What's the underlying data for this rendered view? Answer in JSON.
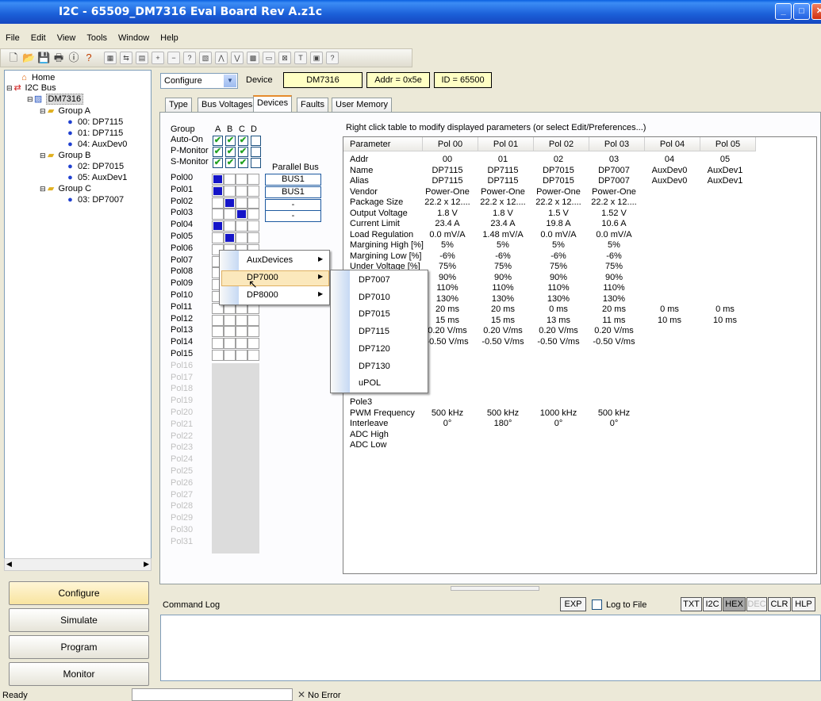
{
  "window": {
    "title": "I2C - 65509_DM7316 Eval Board Rev A.z1c"
  },
  "menu": [
    "File",
    "Edit",
    "View",
    "Tools",
    "Window",
    "Help"
  ],
  "tree": {
    "home": "Home",
    "bus": "I2C Bus",
    "device": "DM7316",
    "group_a": "Group A",
    "a1": "00: DP7115",
    "a2": "01: DP7115",
    "a3": "04: AuxDev0",
    "group_b": "Group B",
    "b1": "02: DP7015",
    "b2": "05: AuxDev1",
    "group_c": "Group C",
    "c1": "03: DP7007"
  },
  "nav": {
    "configure": "Configure",
    "simulate": "Simulate",
    "program": "Program",
    "monitor": "Monitor"
  },
  "topbar": {
    "mode": "Configure",
    "device_label": "Device",
    "device": "DM7316",
    "addr": "Addr = 0x5e",
    "id": "ID = 65500"
  },
  "tabs": [
    "Type",
    "Bus Voltages",
    "Devices",
    "Faults",
    "User Memory"
  ],
  "groups": {
    "label": "Group",
    "cols": [
      "A",
      "B",
      "C",
      "D"
    ],
    "rows": [
      "Auto-On",
      "P-Monitor",
      "S-Monitor"
    ],
    "parallel_bus": "Parallel Bus"
  },
  "pols": [
    "Pol00",
    "Pol01",
    "Pol02",
    "Pol03",
    "Pol04",
    "Pol05",
    "Pol06",
    "Pol07",
    "Pol08",
    "Pol09",
    "Pol10",
    "Pol11",
    "Pol12",
    "Pol13",
    "Pol14",
    "Pol15"
  ],
  "pols_disabled": [
    "Pol16",
    "Pol17",
    "Pol18",
    "Pol19",
    "Pol20",
    "Pol21",
    "Pol22",
    "Pol23",
    "Pol24",
    "Pol25",
    "Pol26",
    "Pol27",
    "Pol28",
    "Pol29",
    "Pol30",
    "Pol31"
  ],
  "busboxes": [
    "BUS1",
    "BUS1",
    "-",
    "-"
  ],
  "hint": "Right click table to modify displayed parameters (or select Edit/Preferences...)",
  "table": {
    "headers": [
      "Parameter",
      "Pol 00",
      "Pol 01",
      "Pol 02",
      "Pol 03",
      "Pol 04",
      "Pol 05"
    ],
    "params": [
      "Addr",
      "Name",
      "Alias",
      "Vendor",
      "Package Size",
      "Output Voltage",
      "Current Limit",
      "Load Regulation",
      "Margining High [%]",
      "Margining Low [%]",
      "Under Voltage [%]"
    ],
    "params_lower": [
      "Pole3",
      "PWM Frequency",
      "Interleave",
      "ADC High",
      "ADC Low"
    ],
    "params_partial": "Pole2",
    "cols": [
      [
        "00",
        "DP7115",
        "DP7115",
        "Power-One",
        "22.2 x 12....",
        "1.8 V",
        "23.4 A",
        "0.0 mV/A",
        "5%",
        "-6%",
        "75%",
        "90%",
        "110%",
        "130%",
        "20 ms",
        "15 ms",
        "0.20 V/ms",
        "-0.50 V/ms"
      ],
      [
        "01",
        "DP7115",
        "DP7115",
        "Power-One",
        "22.2 x 12....",
        "1.8 V",
        "23.4 A",
        "1.48 mV/A",
        "5%",
        "-6%",
        "75%",
        "90%",
        "110%",
        "130%",
        "20 ms",
        "15 ms",
        "0.20 V/ms",
        "-0.50 V/ms"
      ],
      [
        "02",
        "DP7015",
        "DP7015",
        "Power-One",
        "22.2 x 12....",
        "1.5 V",
        "19.8 A",
        "0.0 mV/A",
        "5%",
        "-6%",
        "75%",
        "90%",
        "110%",
        "130%",
        "0 ms",
        "13 ms",
        "0.20 V/ms",
        "-0.50 V/ms"
      ],
      [
        "03",
        "DP7007",
        "DP7007",
        "Power-One",
        "22.2 x 12....",
        "1.52 V",
        "10.6 A",
        "0.0 mV/A",
        "5%",
        "-6%",
        "75%",
        "90%",
        "110%",
        "130%",
        "20 ms",
        "11 ms",
        "0.20 V/ms",
        "-0.50 V/ms"
      ],
      [
        "04",
        "AuxDev0",
        "AuxDev0",
        "",
        "",
        "",
        "",
        "",
        "",
        "",
        "",
        "",
        "",
        "",
        "0 ms",
        "10 ms",
        "",
        ""
      ],
      [
        "05",
        "AuxDev1",
        "AuxDev1",
        "",
        "",
        "",
        "",
        "",
        "",
        "",
        "",
        "",
        "",
        "",
        "0 ms",
        "10 ms",
        "",
        ""
      ]
    ],
    "lower": [
      [
        "500 kHz",
        "0°"
      ],
      [
        "500 kHz",
        "180°"
      ],
      [
        "1000 kHz",
        "0°"
      ],
      [
        "500 kHz",
        "0°"
      ],
      [
        "",
        ""
      ],
      [
        "",
        ""
      ]
    ]
  },
  "context_menu": {
    "items": [
      "AuxDevices",
      "DP7000",
      "DP8000"
    ],
    "submenu": [
      "DP7007",
      "DP7010",
      "DP7015",
      "DP7115",
      "DP7120",
      "DP7130",
      "uPOL"
    ]
  },
  "cmdlog": {
    "title": "Command Log",
    "exp": "EXP",
    "log_to_file": "Log to File",
    "btns": [
      "TXT",
      "I2C",
      "HEX",
      "DEC",
      "CLR",
      "HLP"
    ]
  },
  "status": {
    "ready": "Ready",
    "error": "No Error"
  }
}
